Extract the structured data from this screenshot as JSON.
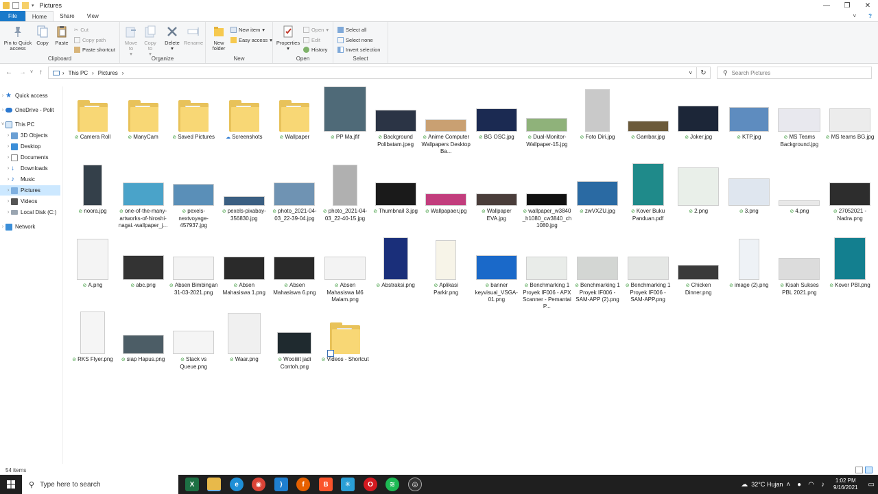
{
  "window": {
    "title": "Pictures"
  },
  "tabs": {
    "file": "File",
    "home": "Home",
    "share": "Share",
    "view": "View"
  },
  "ribbon": {
    "clipboard": {
      "label": "Clipboard",
      "pin": "Pin to Quick access",
      "copy": "Copy",
      "paste": "Paste",
      "cut": "Cut",
      "copy_path": "Copy path",
      "paste_shortcut": "Paste shortcut"
    },
    "organize": {
      "label": "Organize",
      "move_to": "Move to",
      "copy_to": "Copy to",
      "delete": "Delete",
      "rename": "Rename"
    },
    "new": {
      "label": "New",
      "new_folder": "New folder",
      "new_item": "New item",
      "easy_access": "Easy access"
    },
    "open": {
      "label": "Open",
      "properties": "Properties",
      "open": "Open",
      "edit": "Edit",
      "history": "History"
    },
    "select": {
      "label": "Select",
      "select_all": "Select all",
      "select_none": "Select none",
      "invert": "Invert selection"
    }
  },
  "address": {
    "crumb1": "This PC",
    "crumb2": "Pictures",
    "search_placeholder": "Search Pictures"
  },
  "nav": {
    "quick_access": "Quick access",
    "onedrive": "OneDrive - Polit",
    "this_pc": "This PC",
    "objects3d": "3D Objects",
    "desktop": "Desktop",
    "documents": "Documents",
    "downloads": "Downloads",
    "music": "Music",
    "pictures": "Pictures",
    "videos": "Videos",
    "local_disk": "Local Disk (C:)",
    "network": "Network"
  },
  "files": [
    "Camera Roll",
    "ManyCam",
    "Saved Pictures",
    "Screenshots",
    "Wallpaper",
    "PP Ma.jfif",
    "Background Polibatam.jpeg",
    "Anime Computer Wallpapers Desktop Ba...",
    "BG OSC.jpg",
    "Dual-Monitor-Wallpaper-15.jpg",
    "Foto Diri.jpg",
    "Gambar.jpg",
    "Joker.jpg",
    "KTP.jpg",
    "MS Teams Background.jpg",
    "MS teams BG.jpg",
    "noora.jpg",
    "one-of-the-many-artworks-of-hiroshi-nagai.-wallpaper_j...",
    "pexels-nextvoyage-457937.jpg",
    "pexels-pixabay-356830.jpg",
    "photo_2021-04-03_22-39-04.jpg",
    "photo_2021-04-03_22-40-15.jpg",
    "Thumbnail 3.jpg",
    "Wallpapaer.jpg",
    "Wallpaper EVA.jpg",
    "wallpaper_w3840_h1080_cw3840_ch1080.jpg",
    "zwVXZU.jpg",
    "Kover Buku Panduan.pdf",
    "2.png",
    "3.png",
    "4.png",
    "27052021 - Nadra.png",
    "A.png",
    "abc.png",
    "Absen Bimbingan 31-03-2021.png",
    "Absen Mahasiswa 1.png",
    "Absen Mahasiswa 6.png",
    "Absen Mahasiswa M6 Malam.png",
    "Abstraksi.png",
    "Aplikasi Parkir.png",
    "banner keyvisual_VSGA-01.png",
    "Benchmarking 1 Proyek IF006 - APX Scanner - Pemantai P...",
    "Benchmarking 1 Proyek IF006 - SAM-APP (2).png",
    "Benchmarking 1 Proyek IF006 - SAM-APP.png",
    "Chicken Dinner.png",
    "image (2).png",
    "Kisah Sukses PBL 2021.png",
    "Kover PBI.png",
    "RKS Flyer.png",
    "siap Hapus.png",
    "Stack vs Queue.png",
    "Waar.png",
    "Wooiiiit jadi Contoh.png",
    "Videos - Shortcut"
  ],
  "status": {
    "count": "54 items"
  },
  "taskbar": {
    "search_placeholder": "Type here to search",
    "weather": "32°C  Hujan",
    "time": "1:02 PM",
    "date": "9/16/2021"
  }
}
